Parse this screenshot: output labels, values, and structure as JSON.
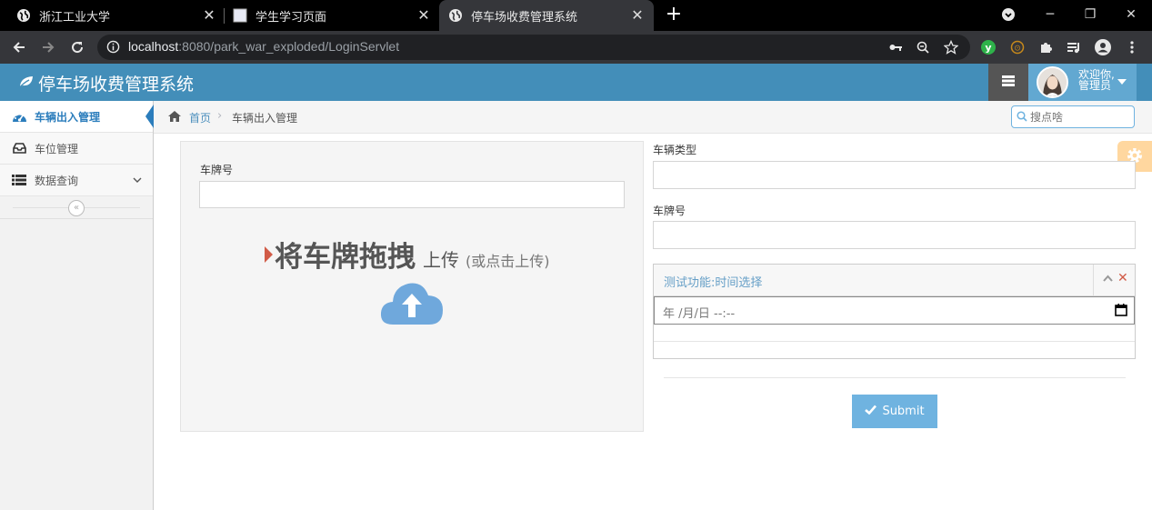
{
  "browser": {
    "tabs": [
      {
        "title": "浙江工业大学"
      },
      {
        "title": "学生学习页面"
      },
      {
        "title": "停车场收费管理系统"
      }
    ],
    "url_host": "localhost",
    "url_rest": ":8080/park_war_exploded/LoginServlet"
  },
  "app": {
    "brand": "停车场收费管理系统",
    "welcome_line1": "欢迎你,",
    "welcome_line2": "管理员",
    "accent": "#438eb9"
  },
  "sidebar": {
    "items": [
      {
        "label": "车辆出入管理",
        "icon": "tachometer-icon"
      },
      {
        "label": "车位管理",
        "icon": "inbox-icon"
      },
      {
        "label": "数据查询",
        "icon": "list-icon"
      }
    ],
    "collapse_glyph": "«"
  },
  "breadcrumb": {
    "home": "首页",
    "separator": "›",
    "current": "车辆出入管理"
  },
  "search": {
    "placeholder": "搜点啥"
  },
  "upload": {
    "plate_label": "车牌号",
    "drop_big": "将车牌拖拽",
    "drop_mid": "上传",
    "drop_small": "(或点击上传)"
  },
  "form": {
    "vehicle_type_label": "车辆类型",
    "plate_label": "车牌号",
    "widget_title": "测试功能:时间选择",
    "date_placeholder": "年 /月/日 --:--",
    "submit_label": "Submit"
  }
}
